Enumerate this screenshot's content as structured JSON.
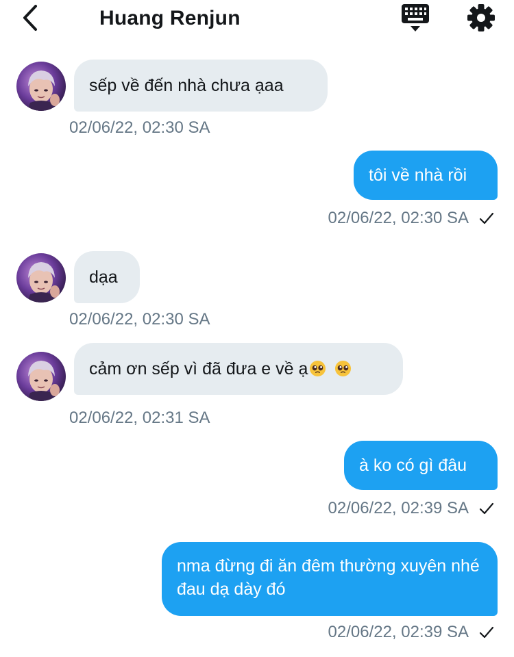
{
  "header": {
    "title": "Huang Renjun",
    "back_icon": "chevron-left-icon",
    "keyboard_icon": "keyboard-icon",
    "settings_icon": "gear-icon"
  },
  "colors": {
    "incoming_bubble": "#e6ecf0",
    "outgoing_bubble": "#1da1f2",
    "timestamp": "#657786"
  },
  "messages": [
    {
      "direction": "in",
      "text": "sếp về đến nhà chưa ạaa",
      "time": "02/06/22, 02:30 SA"
    },
    {
      "direction": "out",
      "text": "tôi về nhà rồi",
      "time": "02/06/22, 02:30 SA",
      "status": "sent"
    },
    {
      "direction": "in",
      "text": "dạa",
      "time": "02/06/22, 02:30 SA"
    },
    {
      "direction": "in",
      "text": "cảm ơn sếp vì đã đưa e về ạ",
      "emoji": [
        "pleading-face",
        "pleading-face"
      ],
      "time": "02/06/22, 02:31 SA"
    },
    {
      "direction": "out",
      "text": "à ko có gì đâu",
      "time": "02/06/22, 02:39 SA",
      "status": "sent"
    },
    {
      "direction": "out",
      "text": "nma đừng đi ăn đêm thường xuyên nhé đau dạ dày đó",
      "time": "02/06/22, 02:39 SA",
      "status": "sent"
    }
  ]
}
